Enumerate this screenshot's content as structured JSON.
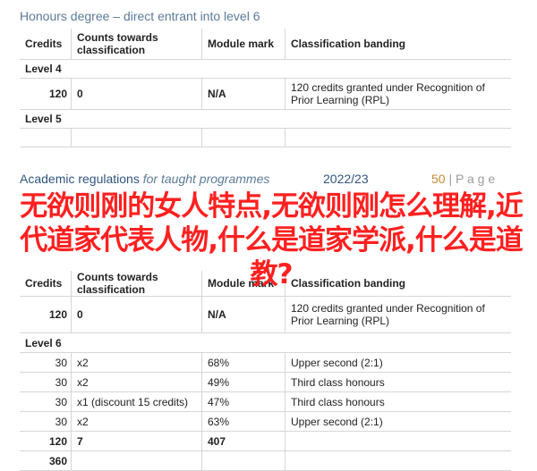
{
  "section1": {
    "title": "Honours degree – direct entrant into level 6",
    "headers": [
      "Credits",
      "Counts towards classification",
      "Module mark",
      "Classification banding"
    ],
    "level4_label": "Level 4",
    "level4_row": {
      "credits": "120",
      "counts": "0",
      "mark": "N/A",
      "banding": "120 credits granted under Recognition of Prior Learning (RPL)"
    },
    "level5_label": "Level 5"
  },
  "footer": {
    "regulations": "Academic regulations",
    "for_taught": "for taught programmes",
    "year": "2022/23",
    "page_num": "50",
    "page_word": "| P a g e"
  },
  "overlay_text": "无欲则刚的女人特点,无欲则刚怎么理解,近代道家代表人物,什么是道家学派,什么是道教?",
  "section2": {
    "headers": [
      "Credits",
      "Counts towards classification",
      "Module mark",
      "Classification banding"
    ],
    "row_rpl": {
      "credits": "120",
      "counts": "0",
      "mark": "N/A",
      "banding": "120 credits granted under Recognition of Prior Learning (RPL)"
    },
    "level6_label": "Level 6",
    "rows": [
      {
        "credits": "30",
        "counts": "x2",
        "mark": "68%",
        "banding": "Upper second (2:1)"
      },
      {
        "credits": "30",
        "counts": "x2",
        "mark": "49%",
        "banding": "Third class honours"
      },
      {
        "credits": "30",
        "counts": "x1 (discount 15 credits)",
        "mark": "47%",
        "banding": "Third class honours"
      },
      {
        "credits": "30",
        "counts": "x2",
        "mark": "63%",
        "banding": "Upper second (2:1)"
      }
    ],
    "total_row": {
      "credits": "120",
      "counts": "7",
      "mark": "407"
    },
    "grand_total": "360"
  }
}
